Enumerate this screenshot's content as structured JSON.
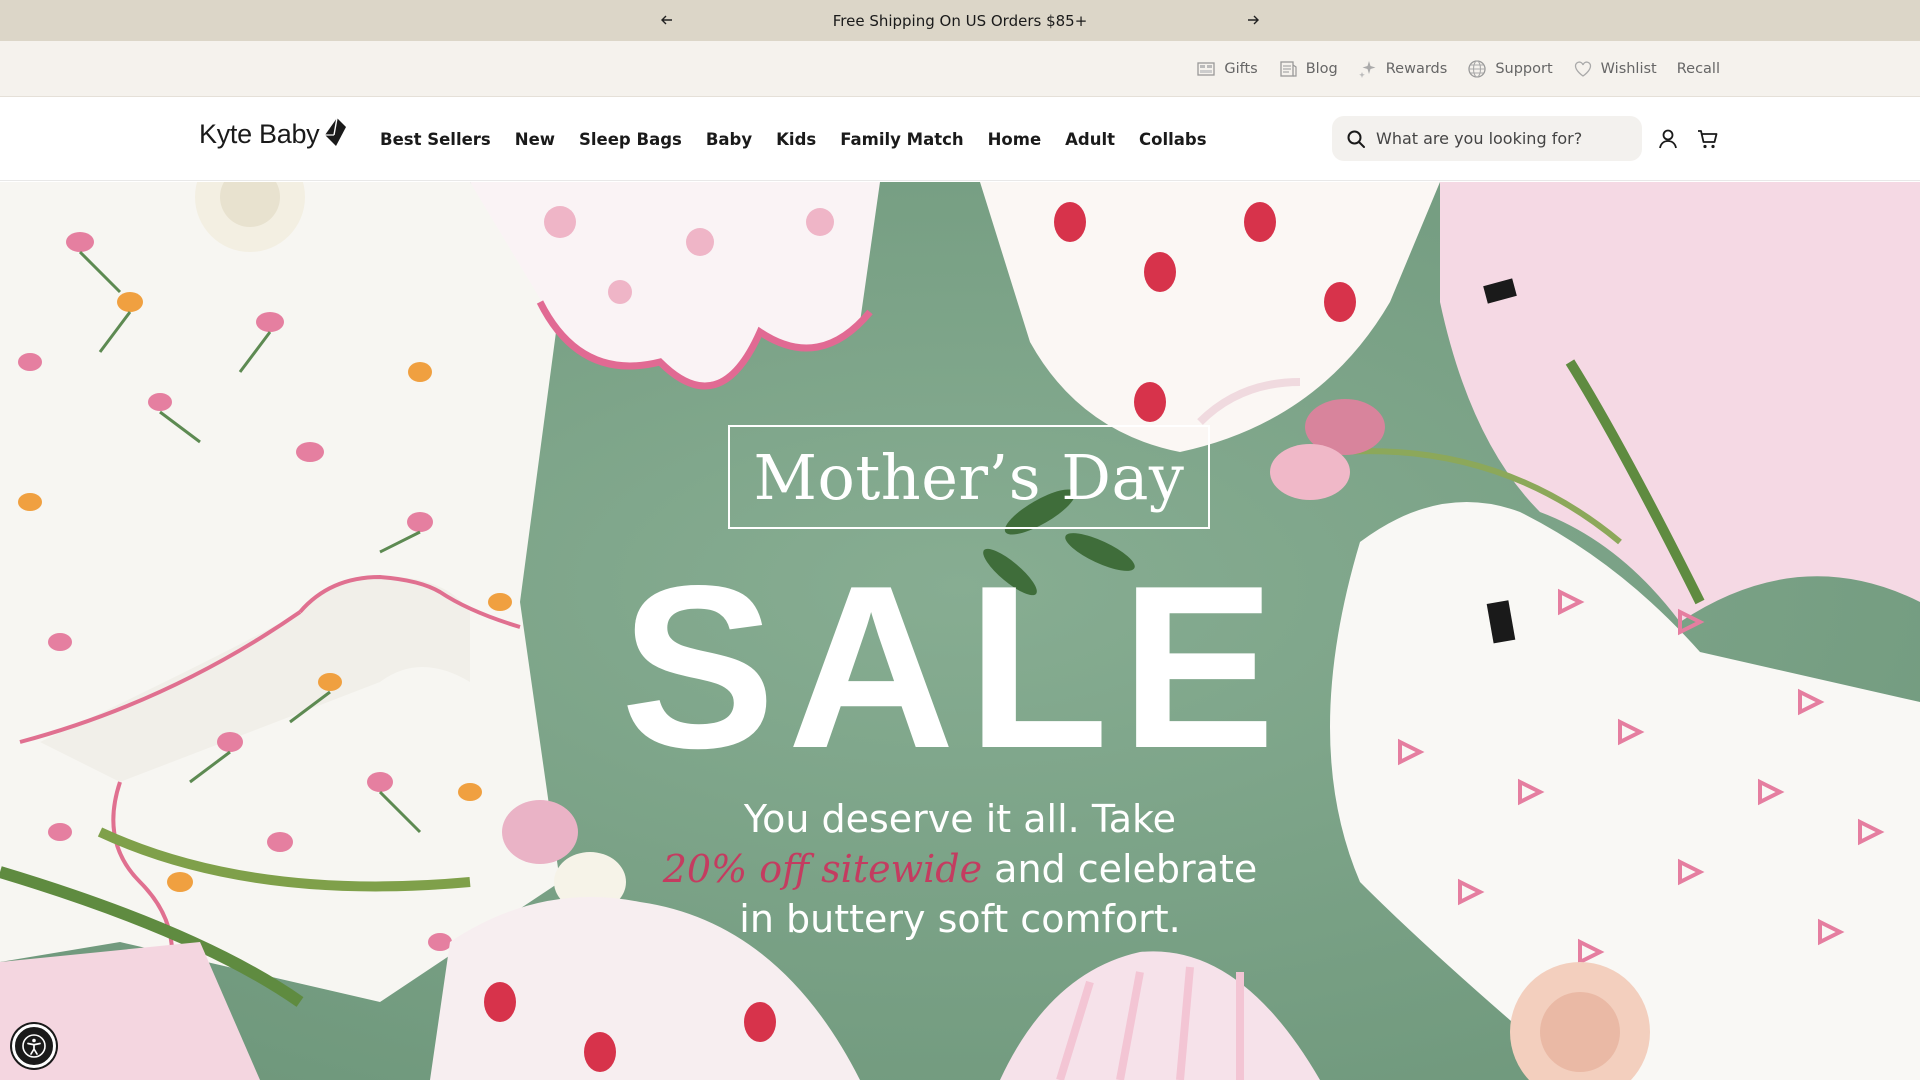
{
  "announcement": {
    "message": "Free Shipping On US Orders $85+",
    "prev_icon": "arrow-left-icon",
    "next_icon": "arrow-right-icon"
  },
  "utility_links": [
    {
      "label": "Gifts",
      "icon": "gift-icon"
    },
    {
      "label": "Blog",
      "icon": "document-icon"
    },
    {
      "label": "Rewards",
      "icon": "sparkle-icon"
    },
    {
      "label": "Support",
      "icon": "globe-icon"
    },
    {
      "label": "Wishlist",
      "icon": "heart-icon"
    },
    {
      "label": "Recall",
      "icon": ""
    }
  ],
  "header": {
    "logo_text": "Kyte Baby",
    "nav": [
      "Best Sellers",
      "New",
      "Sleep Bags",
      "Baby",
      "Kids",
      "Family Match",
      "Home",
      "Adult",
      "Collabs"
    ],
    "search_placeholder": "What are you looking for?",
    "account_icon": "user-icon",
    "cart_icon": "cart-icon"
  },
  "hero": {
    "title": "Mother’s Day",
    "headline": "SALE",
    "copy_line1": "You deserve it all. Take",
    "copy_accent": "20% off sitewide",
    "copy_line2_rest": " and celebrate",
    "copy_line3": "in buttery soft comfort.",
    "background_color": "#7fa68a",
    "accent_color": "#c43c60"
  },
  "accessibility_button": {
    "icon": "accessibility-icon"
  }
}
